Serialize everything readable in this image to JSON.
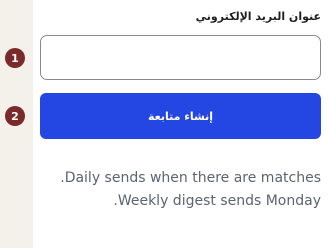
{
  "form": {
    "email_label": "عنوان البريد الإلكتروني",
    "email_value": "",
    "email_placeholder": "",
    "submit_label": "إنشاء متابعة",
    "markers": [
      "1",
      "2"
    ]
  },
  "help": {
    "line1": "Daily sends when there are matches.",
    "line2": "Weekly digest sends Monday."
  },
  "colors": {
    "accent": "#2446e3",
    "marker": "#7a2a2a",
    "strip": "#f3f1ea",
    "help_text": "#5b6470"
  }
}
